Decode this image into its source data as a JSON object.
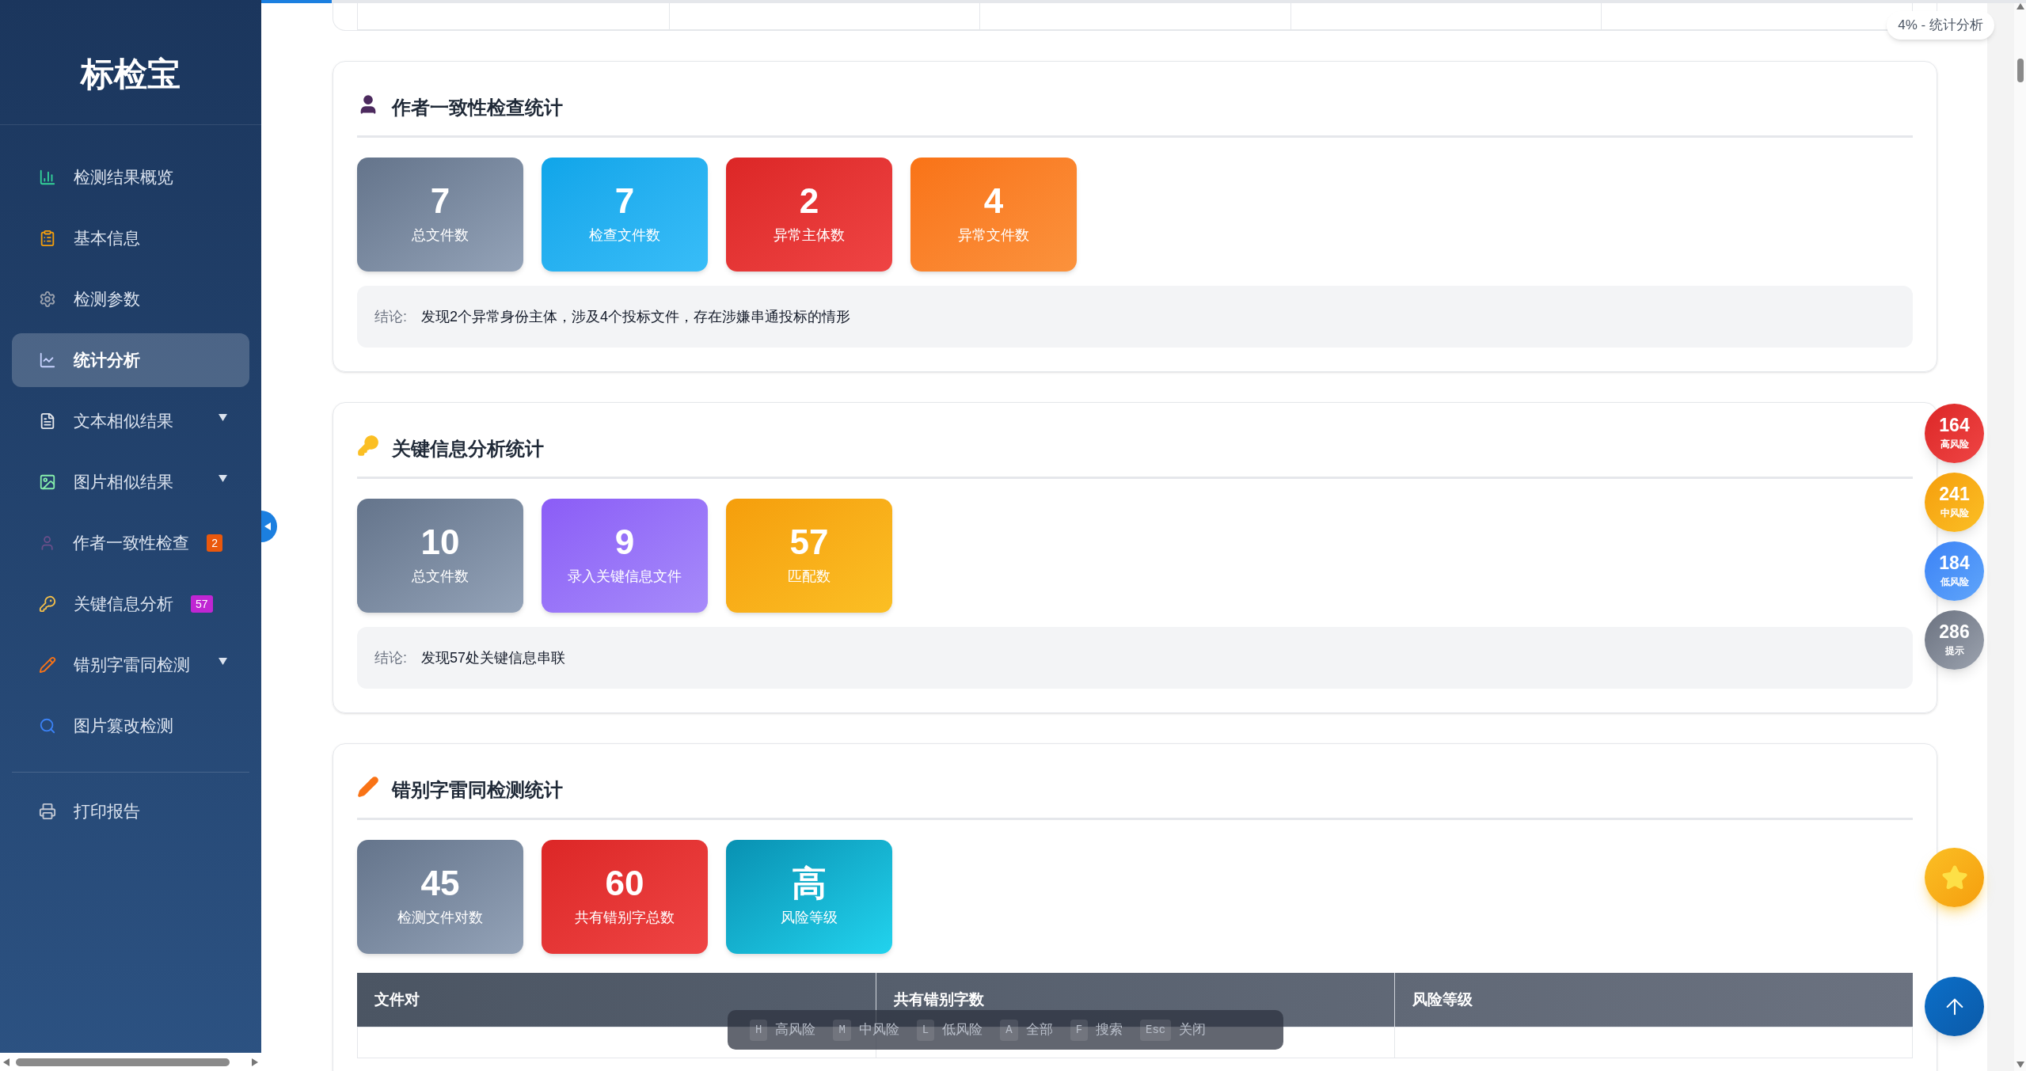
{
  "sidebar": {
    "title": "标检宝",
    "groups": [
      {
        "items": [
          {
            "label": "检测结果概览",
            "selected": false,
            "has_submenu": false
          },
          {
            "label": "基本信息",
            "selected": false,
            "has_submenu": false
          },
          {
            "label": "检测参数",
            "selected": false,
            "has_submenu": false
          },
          {
            "label": "统计分析",
            "selected": true,
            "has_submenu": false
          },
          {
            "label": "文本相似结果",
            "selected": false,
            "has_submenu": true
          },
          {
            "label": "图片相似结果",
            "selected": false,
            "has_submenu": true
          },
          {
            "label": "作者一致性检查",
            "selected": false,
            "has_submenu": false,
            "badge": "2",
            "color": "#ea580c"
          },
          {
            "label": "关键信息分析",
            "selected": false,
            "has_submenu": false,
            "badge": "57",
            "color": "#c026d3"
          },
          {
            "label": "错别字雷同检测",
            "selected": false,
            "has_submenu": true
          },
          {
            "label": "图片篡改检测",
            "selected": false,
            "has_submenu": false
          }
        ]
      },
      {
        "items": [
          {
            "label": "打印报告",
            "selected": false,
            "has_submenu": false
          }
        ]
      }
    ]
  },
  "progress_toast": {
    "text": "4% - 统计分析",
    "level": 0.04
  },
  "sections": [
    {
      "title": "作者一致性检查统计",
      "stats": [
        {
          "value": "7",
          "label": "总文件数",
          "kind": "slate"
        },
        {
          "value": "7",
          "label": "检查文件数",
          "kind": "sky"
        },
        {
          "value": "2",
          "label": "异常主体数",
          "kind": "red"
        },
        {
          "value": "4",
          "label": "异常文件数",
          "kind": "orange"
        }
      ],
      "conclusion": {
        "label": "结论:",
        "text": "发现2个异常身份主体，涉及4个投标文件，存在涉嫌串通投标的情形"
      }
    },
    {
      "title": "关键信息分析统计",
      "stats": [
        {
          "value": "10",
          "label": "总文件数",
          "kind": "slate"
        },
        {
          "value": "9",
          "label": "录入关键信息文件",
          "kind": "violet"
        },
        {
          "value": "57",
          "label": "匹配数",
          "kind": "amber"
        }
      ],
      "conclusion": {
        "label": "结论:",
        "text": "发现57处关键信息串联"
      }
    },
    {
      "title": "错别字雷同检测统计",
      "stats": [
        {
          "value": "45",
          "label": "检测文件对数",
          "kind": "slate"
        },
        {
          "value": "60",
          "label": "共有错别字总数",
          "kind": "red"
        },
        {
          "value": "高",
          "label": "风险等级",
          "kind": "cyan"
        }
      ],
      "table": {
        "columns": [
          "文件对",
          "共有错别字数",
          "风险等级"
        ]
      }
    }
  ],
  "shortcuts": [
    {
      "key": "H",
      "label": "高风险"
    },
    {
      "key": "M",
      "label": "中风险"
    },
    {
      "key": "L",
      "label": "低风险"
    },
    {
      "key": "A",
      "label": "全部"
    },
    {
      "key": "F",
      "label": "搜索"
    },
    {
      "key": "Esc",
      "label": "关闭"
    }
  ],
  "risk_counters": [
    {
      "value": "164",
      "label": "高风险",
      "kind": "high"
    },
    {
      "value": "241",
      "label": "中风险",
      "kind": "medium"
    },
    {
      "value": "184",
      "label": "低风险",
      "kind": "low"
    },
    {
      "value": "286",
      "label": "提示",
      "kind": "hint"
    }
  ]
}
